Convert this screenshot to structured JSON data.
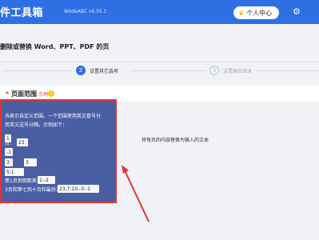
{
  "header": {
    "app_title": "件工具箱",
    "app_version": "WodeABC v6.55.1",
    "user_center_label": "个人中心",
    "crown_icon": "crown-icon",
    "settings_icon": "gear-icon"
  },
  "page": {
    "title": "删除或替换 Word、PPT、PDF 的页"
  },
  "steps": [
    {
      "number": "2",
      "label": "设置其它选项",
      "state": "active"
    },
    {
      "number": "3",
      "label": "设置输出目录",
      "state": "pending"
    }
  ],
  "form": {
    "required_mark": "*",
    "range_label": "页面范围",
    "example_tag": "示例",
    "info_icon": "?",
    "right_hint": "将每页的内容替换为输入的文本"
  },
  "tooltip": {
    "line1": "去表示自定义范围，一个范围使用英文冒号分",
    "line2": "用英文逗号分隔。示例如下：",
    "line5": "页：",
    "line9": "第1页到倒数第二页：",
    "line10": "3页和第七到十页和最后三页：",
    "code1": "1",
    "code2": "23",
    "code3": "-1",
    "code4": "3",
    "code5": "3",
    "code6": "5:1",
    "code7": "1:-2",
    "code8": "23,7:10,-3:-1"
  },
  "colors": {
    "primary": "#2f6fe4",
    "highlight_border": "#e63232",
    "tooltip_bg": "#4a5fa3"
  }
}
